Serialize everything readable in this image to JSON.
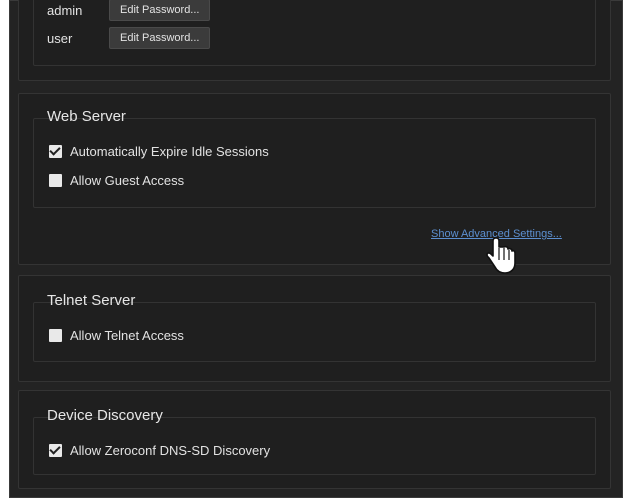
{
  "users": {
    "rows": [
      {
        "name": "admin",
        "button_label": "Edit Password..."
      },
      {
        "name": "user",
        "button_label": "Edit Password..."
      }
    ]
  },
  "web_server": {
    "title": "Web Server",
    "options": [
      {
        "label": "Automatically Expire Idle Sessions",
        "checked": true
      },
      {
        "label": "Allow Guest Access",
        "checked": false
      }
    ],
    "advanced_link": "Show Advanced Settings..."
  },
  "telnet_server": {
    "title": "Telnet Server",
    "options": [
      {
        "label": "Allow Telnet Access",
        "checked": false
      }
    ]
  },
  "device_discovery": {
    "title": "Device Discovery",
    "options": [
      {
        "label": "Allow Zeroconf DNS-SD Discovery",
        "checked": true
      }
    ]
  },
  "colors": {
    "background": "#232323",
    "panel": "#1f1f1f",
    "link": "#5c8fd0"
  },
  "icons": {
    "cursor": "hand-pointer-icon",
    "checked": "checkbox-checked-icon",
    "unchecked": "checkbox-unchecked-icon"
  }
}
